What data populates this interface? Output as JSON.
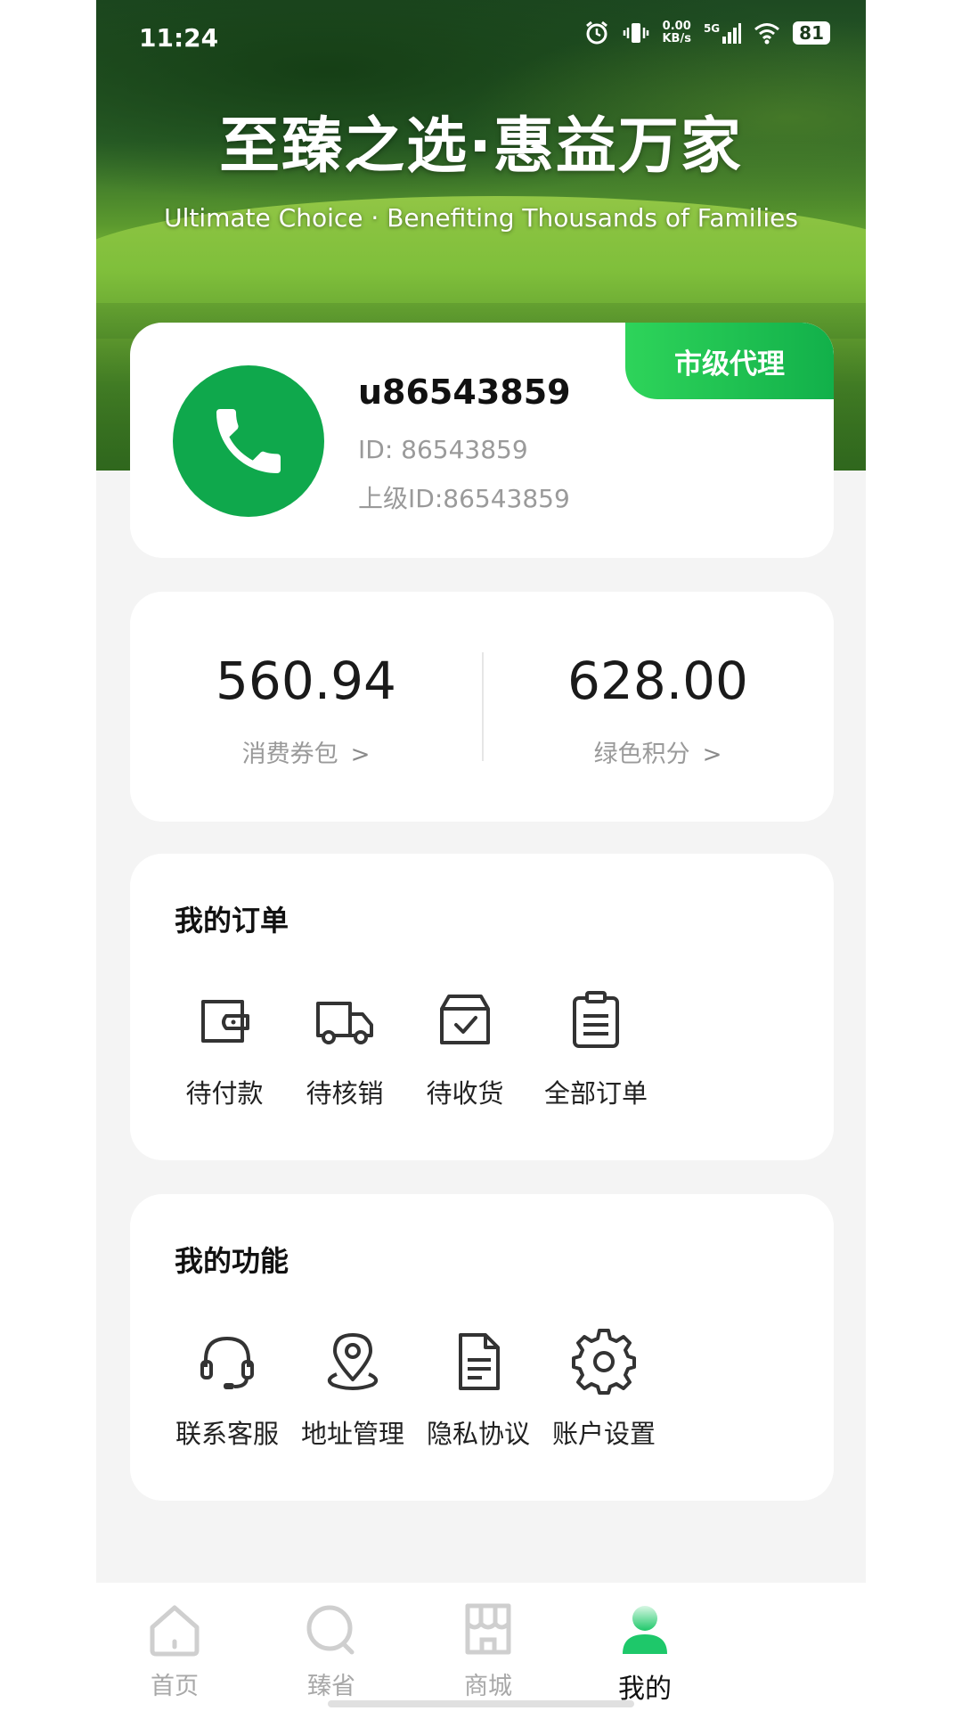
{
  "status_bar": {
    "time": "11:24",
    "net_speed_value": "0.00",
    "net_speed_unit": "KB/s",
    "network": "5G",
    "battery": "81"
  },
  "hero": {
    "title": "至臻之选·惠益万家",
    "subtitle": "Ultimate Choice · Benefiting Thousands of Families"
  },
  "profile": {
    "badge": "市级代理",
    "username": "u86543859",
    "id_line": "ID: 86543859",
    "parent_id_line": "上级ID:86543859",
    "avatar_icon": "phone-icon",
    "avatar_color": "#0fa84c"
  },
  "wallet": {
    "voucher": {
      "value": "560.94",
      "label": "消费券包"
    },
    "points": {
      "value": "628.00",
      "label": "绿色积分"
    }
  },
  "orders": {
    "title": "我的订单",
    "items": [
      {
        "label": "待付款",
        "icon": "wallet-icon"
      },
      {
        "label": "待核销",
        "icon": "truck-icon"
      },
      {
        "label": "待收货",
        "icon": "box-check-icon"
      },
      {
        "label": "全部订单",
        "icon": "clipboard-icon"
      }
    ]
  },
  "functions": {
    "title": "我的功能",
    "items": [
      {
        "label": "联系客服",
        "icon": "headset-icon"
      },
      {
        "label": "地址管理",
        "icon": "location-pin-icon"
      },
      {
        "label": "隐私协议",
        "icon": "document-icon"
      },
      {
        "label": "账户设置",
        "icon": "gear-icon"
      }
    ]
  },
  "tabbar": {
    "active_color": "#1ec86a",
    "items": [
      {
        "label": "首页",
        "icon": "home-icon",
        "active": false
      },
      {
        "label": "臻省",
        "icon": "search-icon",
        "active": false
      },
      {
        "label": "商城",
        "icon": "store-icon",
        "active": false
      },
      {
        "label": "我的",
        "icon": "user-icon",
        "active": true
      }
    ]
  }
}
